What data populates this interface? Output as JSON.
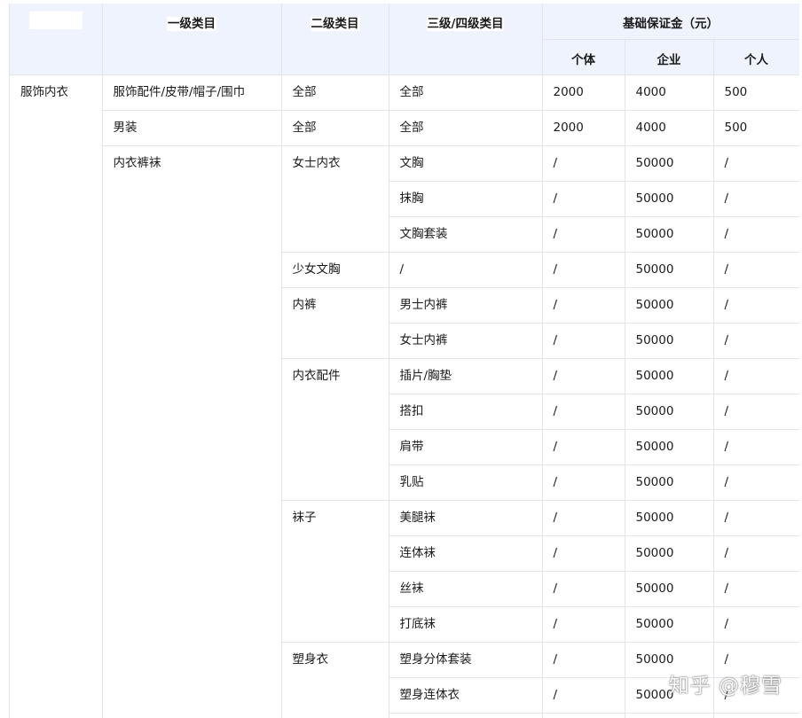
{
  "header": {
    "col1": "",
    "col2": "一级类目",
    "col3": "二级类目",
    "col4": "三级/四级类目",
    "deposit_group": "基础保证金（元）",
    "deposit_cols": [
      "个体",
      "企业",
      "个人"
    ]
  },
  "rows": {
    "top_category": "服饰内衣",
    "r1": {
      "level1": "服饰配件/皮带/帽子/围巾",
      "level2": "全部",
      "level3": "全部",
      "v1": "2000",
      "v2": "4000",
      "v3": "500"
    },
    "r2": {
      "level1": "男装",
      "level2": "全部",
      "level3": "全部",
      "v1": "2000",
      "v2": "4000",
      "v3": "500"
    },
    "underwear_level1": "内衣裤袜",
    "groups": [
      {
        "level2": "女士内衣",
        "items": [
          {
            "level3": "文胸",
            "v1": "/",
            "v2": "50000",
            "v3": "/"
          },
          {
            "level3": "抹胸",
            "v1": "/",
            "v2": "50000",
            "v3": "/"
          },
          {
            "level3": "文胸套装",
            "v1": "/",
            "v2": "50000",
            "v3": "/"
          }
        ]
      },
      {
        "level2": "少女文胸",
        "items": [
          {
            "level3": "/",
            "v1": "/",
            "v2": "50000",
            "v3": "/"
          }
        ]
      },
      {
        "level2": "内裤",
        "items": [
          {
            "level3": "男士内裤",
            "v1": "/",
            "v2": "50000",
            "v3": "/"
          },
          {
            "level3": "女士内裤",
            "v1": "/",
            "v2": "50000",
            "v3": "/"
          }
        ]
      },
      {
        "level2": "内衣配件",
        "items": [
          {
            "level3": "插片/胸垫",
            "v1": "/",
            "v2": "50000",
            "v3": "/"
          },
          {
            "level3": "搭扣",
            "v1": "/",
            "v2": "50000",
            "v3": "/"
          },
          {
            "level3": "肩带",
            "v1": "/",
            "v2": "50000",
            "v3": "/"
          },
          {
            "level3": "乳贴",
            "v1": "/",
            "v2": "50000",
            "v3": "/"
          }
        ]
      },
      {
        "level2": "袜子",
        "items": [
          {
            "level3": "美腿袜",
            "v1": "/",
            "v2": "50000",
            "v3": "/"
          },
          {
            "level3": "连体袜",
            "v1": "/",
            "v2": "50000",
            "v3": "/"
          },
          {
            "level3": "丝袜",
            "v1": "/",
            "v2": "50000",
            "v3": "/"
          },
          {
            "level3": "打底袜",
            "v1": "/",
            "v2": "50000",
            "v3": "/"
          }
        ]
      },
      {
        "level2": "塑身衣",
        "items": [
          {
            "level3": "塑身分体套装",
            "v1": "/",
            "v2": "50000",
            "v3": "/"
          },
          {
            "level3": "塑身连体衣",
            "v1": "/",
            "v2": "50000",
            "v3": "/"
          },
          {
            "level3": "",
            "v1": "",
            "v2": "",
            "v3": ""
          }
        ]
      }
    ]
  },
  "watermark": "知乎 @穆雪"
}
